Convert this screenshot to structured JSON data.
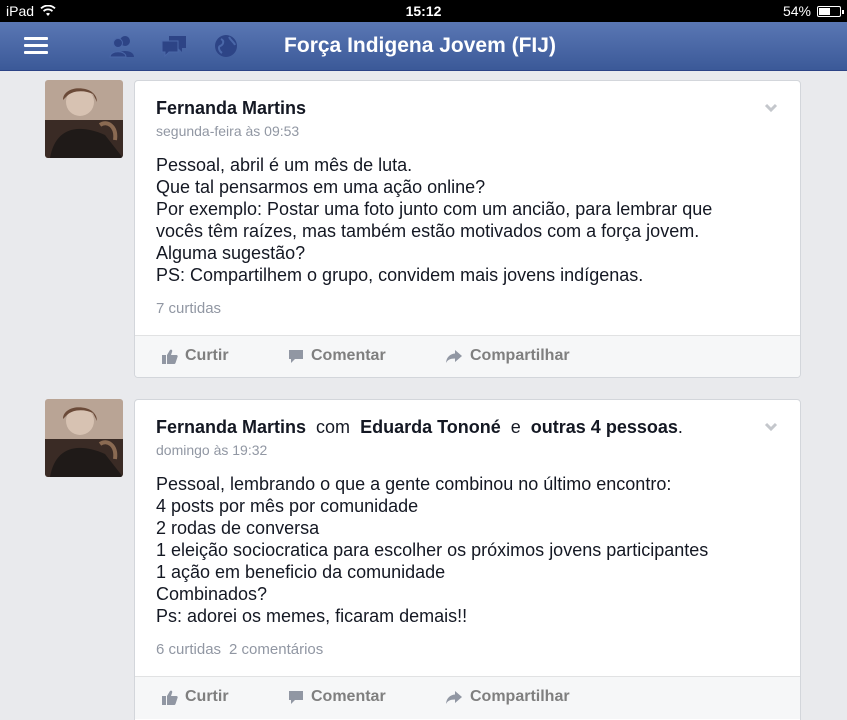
{
  "status_bar": {
    "device": "iPad",
    "time": "15:12",
    "battery": "54%",
    "battery_level": 0.54
  },
  "nav": {
    "title": "Força Indigena Jovem (FIJ)"
  },
  "posts": [
    {
      "author": "Fernanda Martins",
      "with_word": "",
      "tagged": "",
      "and_word": "",
      "others": "",
      "period": "",
      "timestamp": "segunda-feira às 09:53",
      "lines": [
        "Pessoal, abril é um mês de luta.",
        "Que tal pensarmos em uma ação online?",
        "Por exemplo: Postar uma foto junto com um ancião, para lembrar que",
        "vocês têm raízes, mas também estão motivados com a força jovem.",
        "Alguma sugestão?",
        "PS: Compartilhem o grupo, convidem mais jovens indígenas."
      ],
      "likes": "7 curtidas",
      "comments": "",
      "actions": {
        "like": "Curtir",
        "comment": "Comentar",
        "share": "Compartilhar"
      }
    },
    {
      "author": "Fernanda Martins",
      "with_word": "com",
      "tagged": "Eduarda Tononé",
      "and_word": "e",
      "others": "outras 4 pessoas",
      "period": ".",
      "timestamp": "domingo às 19:32",
      "lines": [
        "Pessoal, lembrando o que a gente combinou no último encontro:",
        "4 posts por mês por comunidade",
        "2 rodas de conversa",
        "1 eleição sociocratica para escolher os próximos jovens participantes",
        "1 ação em beneficio da comunidade",
        "Combinados?",
        "Ps: adorei os memes, ficaram demais!!"
      ],
      "likes": "6 curtidas",
      "comments": "2 comentários",
      "actions": {
        "like": "Curtir",
        "comment": "Comentar",
        "share": "Compartilhar"
      }
    }
  ],
  "colors": {
    "brand": "#3b5998",
    "background": "#e9eaed",
    "muted": "#9197a3"
  }
}
